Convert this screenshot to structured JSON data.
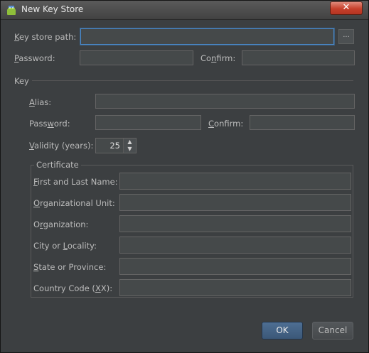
{
  "window": {
    "title": "New Key Store",
    "close_glyph": "✕",
    "icon": "android-icon"
  },
  "keystore": {
    "path_label": "Key store path:",
    "path_value": "",
    "browse_label": "...",
    "password_label": "Password:",
    "password_value": "",
    "confirm_label": "Confirm:",
    "confirm_value": ""
  },
  "key": {
    "section_label": "Key",
    "alias_label": "Alias:",
    "alias_value": "",
    "password_label": "Password:",
    "password_value": "",
    "confirm_label": "Confirm:",
    "confirm_value": "",
    "validity_label": "Validity (years):",
    "validity_value": "25"
  },
  "certificate": {
    "section_label": "Certificate",
    "fields": [
      {
        "label": "First and Last Name:",
        "value": ""
      },
      {
        "label": "Organizational Unit:",
        "value": ""
      },
      {
        "label": "Organization:",
        "value": ""
      },
      {
        "label": "City or Locality:",
        "value": ""
      },
      {
        "label": "State or Province:",
        "value": ""
      },
      {
        "label": "Country Code (XX):",
        "value": ""
      }
    ]
  },
  "buttons": {
    "ok": "OK",
    "cancel": "Cancel"
  },
  "colors": {
    "background": "#3c3f41",
    "focus": "#4a88c7",
    "ok_button": "#3b5878",
    "close_button": "#c7402b"
  }
}
